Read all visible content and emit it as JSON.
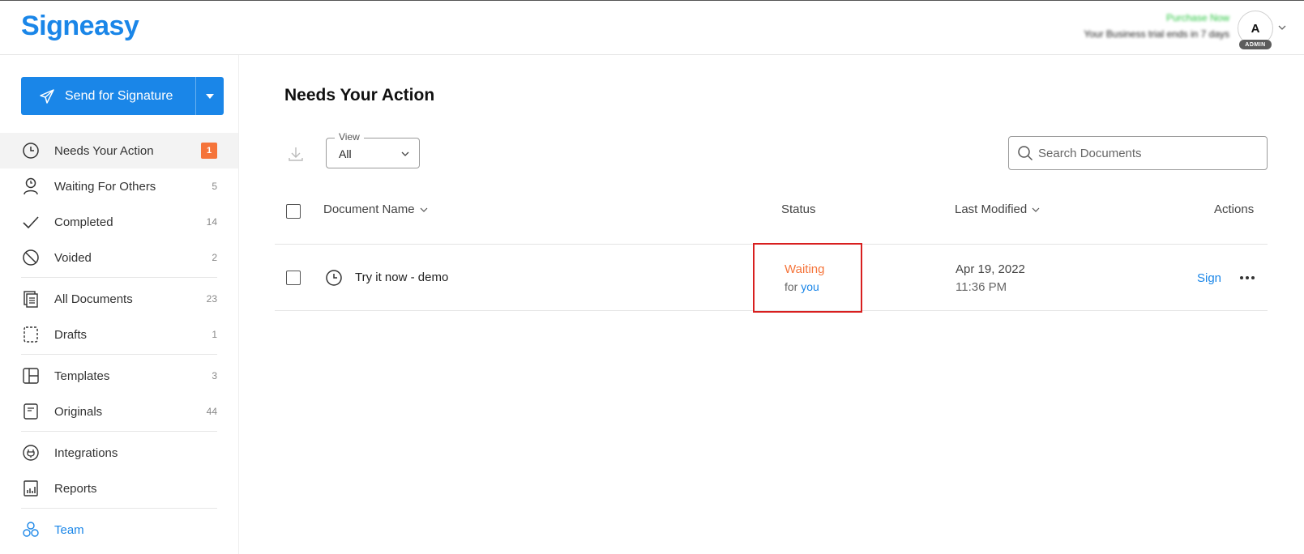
{
  "header": {
    "logo": "Signeasy",
    "promo_link": "Purchase Now",
    "promo_text": "Your Business trial ends in 7 days",
    "avatar_initial": "A",
    "avatar_badge": "ADMIN"
  },
  "sidebar": {
    "send_label": "Send for Signature",
    "items": [
      {
        "label": "Needs Your Action",
        "count": "1",
        "icon": "clock-icon"
      },
      {
        "label": "Waiting For Others",
        "count": "5",
        "icon": "person-clock-icon"
      },
      {
        "label": "Completed",
        "count": "14",
        "icon": "check-icon"
      },
      {
        "label": "Voided",
        "count": "2",
        "icon": "ban-icon"
      },
      {
        "label": "All Documents",
        "count": "23",
        "icon": "documents-icon"
      },
      {
        "label": "Drafts",
        "count": "1",
        "icon": "draft-icon"
      },
      {
        "label": "Templates",
        "count": "3",
        "icon": "template-icon"
      },
      {
        "label": "Originals",
        "count": "44",
        "icon": "original-icon"
      },
      {
        "label": "Integrations",
        "count": "",
        "icon": "plug-icon"
      },
      {
        "label": "Reports",
        "count": "",
        "icon": "reports-icon"
      },
      {
        "label": "Team",
        "count": "",
        "icon": "team-icon"
      }
    ]
  },
  "main": {
    "title": "Needs Your Action",
    "view_label": "View",
    "view_value": "All",
    "search_placeholder": "Search Documents",
    "columns": {
      "name": "Document Name",
      "status": "Status",
      "modified": "Last Modified",
      "actions": "Actions"
    },
    "rows": [
      {
        "name": "Try it now - demo",
        "status": "Waiting",
        "status_for": "for",
        "status_who": "you",
        "date": "Apr 19, 2022",
        "time": "11:36 PM",
        "action": "Sign"
      }
    ]
  },
  "colors": {
    "brand": "#1a86e8",
    "badge": "#f5743a",
    "highlight": "#d81f1f"
  }
}
